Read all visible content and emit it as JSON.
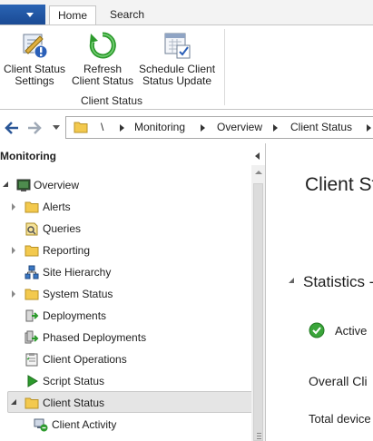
{
  "ribbon": {
    "tabs": [
      {
        "label": "Home",
        "active": true
      },
      {
        "label": "Search",
        "active": false
      }
    ],
    "buttons": [
      {
        "label_line1": "Client Status",
        "label_line2": "Settings",
        "icon": "client-status-settings-icon"
      },
      {
        "label_line1": "Refresh",
        "label_line2": "Client Status",
        "icon": "refresh-icon"
      },
      {
        "label_line1": "Schedule Client",
        "label_line2": "Status Update",
        "icon": "schedule-update-icon"
      }
    ],
    "group_label": "Client Status"
  },
  "address_bar": {
    "root": "\\",
    "crumbs": [
      "Monitoring",
      "Overview",
      "Client Status"
    ]
  },
  "nav_pane": {
    "title": "Monitoring",
    "items": [
      {
        "label": "Overview",
        "icon": "overview-icon",
        "expander": "open"
      },
      {
        "label": "Alerts",
        "icon": "folder-icon",
        "expander": "closed"
      },
      {
        "label": "Queries",
        "icon": "queries-icon",
        "expander": "none"
      },
      {
        "label": "Reporting",
        "icon": "folder-icon",
        "expander": "closed"
      },
      {
        "label": "Site Hierarchy",
        "icon": "site-hierarchy-icon",
        "expander": "none"
      },
      {
        "label": "System Status",
        "icon": "folder-icon",
        "expander": "closed"
      },
      {
        "label": "Deployments",
        "icon": "deployments-icon",
        "expander": "none"
      },
      {
        "label": "Phased Deployments",
        "icon": "phased-deployments-icon",
        "expander": "none"
      },
      {
        "label": "Client Operations",
        "icon": "client-operations-icon",
        "expander": "none"
      },
      {
        "label": "Script Status",
        "icon": "script-status-icon",
        "expander": "none"
      },
      {
        "label": "Client Status",
        "icon": "folder-icon",
        "expander": "open",
        "selected": true
      },
      {
        "label": "Client Activity",
        "icon": "client-activity-icon",
        "expander": "none"
      }
    ]
  },
  "content": {
    "title": "Client St",
    "statistics_title": "Statistics -",
    "active_label": "Active",
    "overall_label": "Overall Cli",
    "total_label": "Total device"
  },
  "colors": {
    "file_tab": "#1f55a5",
    "folder": "#f3c94e",
    "refresh_green": "#2c9a2c",
    "selected_row": "#e5e5e5",
    "check_green": "#3aa53a"
  }
}
